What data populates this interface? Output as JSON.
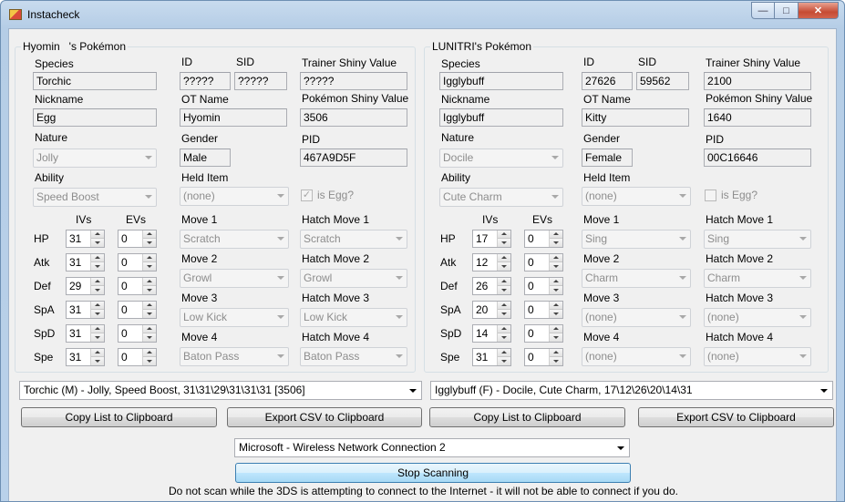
{
  "window": {
    "title": "Instacheck"
  },
  "left": {
    "group_title": "Hyomin   's Pokémon",
    "labels": {
      "species": "Species",
      "id": "ID",
      "sid": "SID",
      "tsv": "Trainer Shiny Value",
      "nickname": "Nickname",
      "ot": "OT Name",
      "psv": "Pokémon Shiny Value",
      "nature": "Nature",
      "gender": "Gender",
      "pid": "PID",
      "ability": "Ability",
      "held": "Held Item",
      "ivs": "IVs",
      "evs": "EVs",
      "move1": "Move 1",
      "move2": "Move 2",
      "move3": "Move 3",
      "move4": "Move 4",
      "hmove1": "Hatch Move 1",
      "hmove2": "Hatch Move 2",
      "hmove3": "Hatch Move 3",
      "hmove4": "Hatch Move 4"
    },
    "species": "Torchic",
    "id": "?????",
    "sid": "?????",
    "tsv": "?????",
    "nickname": "Egg",
    "ot": "Hyomin",
    "psv": "3506",
    "nature": "Jolly",
    "gender": "Male",
    "pid": "467A9D5F",
    "ability": "Speed Boost",
    "held": "(none)",
    "is_egg_label": "is Egg?",
    "is_egg": true,
    "stats": [
      {
        "name": "HP",
        "iv": "31",
        "ev": "0"
      },
      {
        "name": "Atk",
        "iv": "31",
        "ev": "0"
      },
      {
        "name": "Def",
        "iv": "29",
        "ev": "0"
      },
      {
        "name": "SpA",
        "iv": "31",
        "ev": "0"
      },
      {
        "name": "SpD",
        "iv": "31",
        "ev": "0"
      },
      {
        "name": "Spe",
        "iv": "31",
        "ev": "0"
      }
    ],
    "moves": [
      "Scratch",
      "Growl",
      "Low Kick",
      "Baton Pass"
    ],
    "hatch_moves": [
      "Scratch",
      "Growl",
      "Low Kick",
      "Baton Pass"
    ],
    "summary": "Torchic (M) - Jolly, Speed Boost, 31\\31\\29\\31\\31\\31 [3506]",
    "copy_btn": "Copy List to Clipboard",
    "csv_btn": "Export CSV to Clipboard"
  },
  "right": {
    "group_title": "LUNITRI's Pokémon",
    "labels": {
      "species": "Species",
      "id": "ID",
      "sid": "SID",
      "tsv": "Trainer Shiny Value",
      "nickname": "Nickname",
      "ot": "OT Name",
      "psv": "Pokémon Shiny Value",
      "nature": "Nature",
      "gender": "Gender",
      "pid": "PID",
      "ability": "Ability",
      "held": "Held Item",
      "ivs": "IVs",
      "evs": "EVs",
      "move1": "Move 1",
      "move2": "Move 2",
      "move3": "Move 3",
      "move4": "Move 4",
      "hmove1": "Hatch Move 1",
      "hmove2": "Hatch Move 2",
      "hmove3": "Hatch Move 3",
      "hmove4": "Hatch Move 4"
    },
    "species": "Igglybuff",
    "id": "27626",
    "sid": "59562",
    "tsv": "2100",
    "nickname": "Igglybuff",
    "ot": "Kitty",
    "psv": "1640",
    "nature": "Docile",
    "gender": "Female",
    "pid": "00C16646",
    "ability": "Cute Charm",
    "held": "(none)",
    "is_egg_label": "is Egg?",
    "is_egg": false,
    "stats": [
      {
        "name": "HP",
        "iv": "17",
        "ev": "0"
      },
      {
        "name": "Atk",
        "iv": "12",
        "ev": "0"
      },
      {
        "name": "Def",
        "iv": "26",
        "ev": "0"
      },
      {
        "name": "SpA",
        "iv": "20",
        "ev": "0"
      },
      {
        "name": "SpD",
        "iv": "14",
        "ev": "0"
      },
      {
        "name": "Spe",
        "iv": "31",
        "ev": "0"
      }
    ],
    "moves": [
      "Sing",
      "Charm",
      "(none)",
      "(none)"
    ],
    "hatch_moves": [
      "Sing",
      "Charm",
      "(none)",
      "(none)"
    ],
    "summary": "Igglybuff (F) - Docile, Cute Charm, 17\\12\\26\\20\\14\\31",
    "copy_btn": "Copy List to Clipboard",
    "csv_btn": "Export CSV to Clipboard"
  },
  "network": "Microsoft - Wireless Network Connection 2",
  "stop_btn": "Stop Scanning",
  "warning": "Do not scan while the 3DS is attempting to connect to the Internet - it will not be able to connect if you do."
}
